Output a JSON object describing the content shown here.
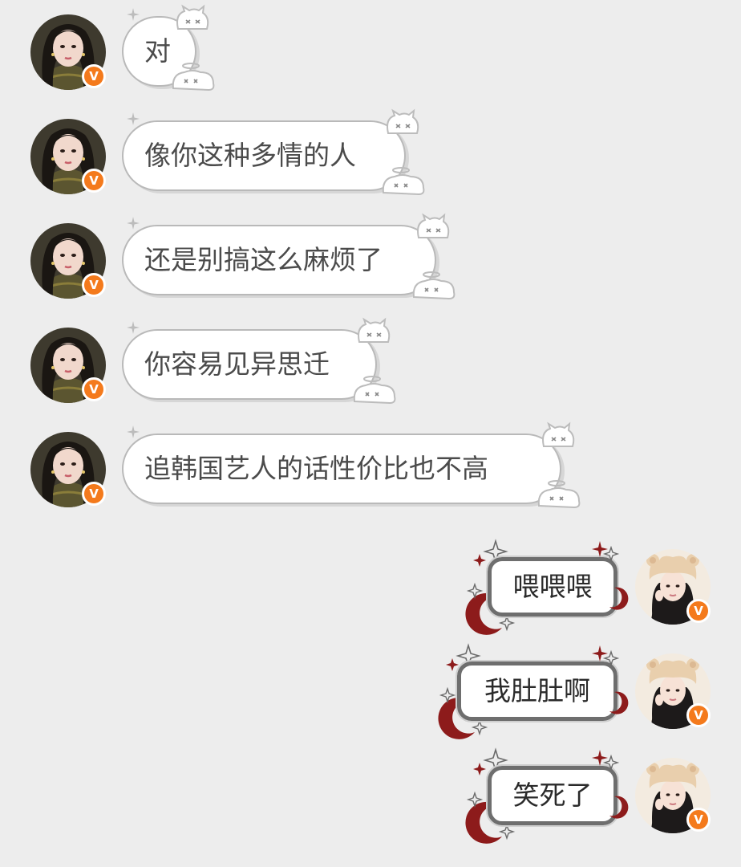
{
  "conversation": {
    "incoming": [
      {
        "text": "对"
      },
      {
        "text": "像你这种多情的人"
      },
      {
        "text": "还是别搞这么麻烦了"
      },
      {
        "text": "你容易见异思迁"
      },
      {
        "text": "追韩国艺人的话性价比也不高"
      }
    ],
    "outgoing": [
      {
        "text": "喂喂喂"
      },
      {
        "text": "我肚肚啊"
      },
      {
        "text": "笑死了"
      }
    ]
  },
  "badge": {
    "label": "V",
    "color": "#f47a1c"
  },
  "icons": {
    "incoming_decoration": "cat-sticker-icon",
    "outgoing_decoration": "crescent-moon-sparkle-icon"
  },
  "colors": {
    "background": "#ededed",
    "bubble_in_border": "#b9b9b9",
    "bubble_out_border": "#6e6e6e",
    "moon": "#8d1b1b"
  }
}
